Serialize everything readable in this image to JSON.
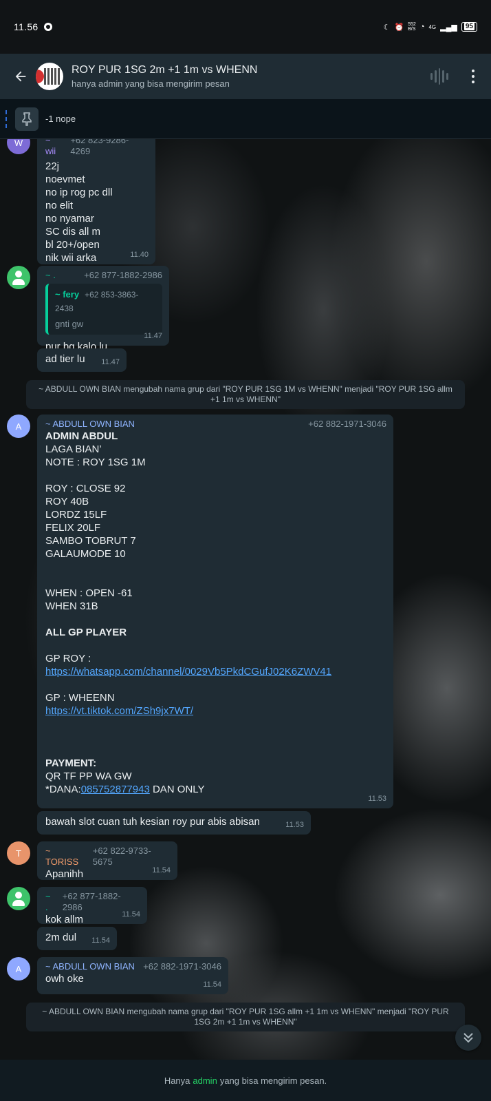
{
  "status_bar": {
    "time": "11.56",
    "net_speed_top": "552",
    "net_speed_bottom": "B/S",
    "network": "4G",
    "battery": "95"
  },
  "header": {
    "title": "ROY PUR 1SG 2m +1 1m vs WHENN",
    "subtitle": "hanya admin yang bisa mengirim pesan"
  },
  "pinned": {
    "text": "-1 nope"
  },
  "messages": {
    "m1": {
      "avatar_letter": "W",
      "name": "~ wii",
      "phone": "+62 823-9286-4269",
      "body": "22j\nnoevmet\nno ip rog pc dll\nno elit\nno nyamar\nSC dis all m\nbl 20+/open\nnik wii arka",
      "time": "11.40",
      "name_color": "#a78bfa"
    },
    "m2": {
      "name": "~ .",
      "phone": "+62 877-1882-2986",
      "quote_name": "~ fery",
      "quote_phone": "+62 853-3863-2438",
      "quote_text": "gnti gw",
      "body": "pur bg kalo lu",
      "time": "11.47",
      "name_color": "#06cf9c"
    },
    "m3": {
      "body": "ad tier lu",
      "time": "11.47"
    },
    "sys1": "~ ABDULL OWN BIAN mengubah nama grup dari \"ROY PUR 1SG 1M vs WHENN\" menjadi \"ROY PUR 1SG allm +1 1m vs WHENN\"",
    "m4": {
      "avatar_letter": "A",
      "name": "~ ABDULL OWN BIAN",
      "phone": "+62 882-1971-3046",
      "line_admin": "ADMIN ABDUL",
      "lines_1": "LAGA BIAN’\nNOTE : ROY 1SG 1M\n\nROY : CLOSE 92\nROY 40B\nLORDZ 15LF\nFELIX 20LF\nSAMBO TOBRUT 7\nGALAUMODE 10\n\n\nWHEN : OPEN -61\nWHEN 31B\n\n",
      "line_allgp": "ALL GP PLAYER",
      "gp_roy_label": "GP ROY :",
      "gp_roy_link": "https://whatsapp.com/channel/0029Vb5PkdCGufJ02K6ZWV41",
      "gp_when_label": "GP : WHEENN",
      "gp_when_link": "https://vt.tiktok.com/ZSh9jx7WT/",
      "payment_label": "PAYMENT:",
      "payment_line": "QR TF PP WA GW",
      "dana_prefix": "*DANA:",
      "dana_number": "085752877943",
      "dana_suffix": " DAN ONLY",
      "time": "11.53",
      "name_color": "#8fb4ff"
    },
    "m5": {
      "body": "bawah slot cuan tuh kesian roy pur abis abisan",
      "time": "11.53"
    },
    "m6": {
      "avatar_letter": "T",
      "name": "~ TORISS",
      "phone": "+62 822-9733-5675",
      "body": "Apanihh",
      "time": "11.54",
      "name_color": "#f39c6b"
    },
    "m7": {
      "name": "~ .",
      "phone": "+62 877-1882-2986",
      "body": "kok allm",
      "time": "11.54",
      "name_color": "#06cf9c"
    },
    "m8": {
      "body": "2m dul",
      "time": "11.54"
    },
    "m9": {
      "avatar_letter": "A",
      "name": "~ ABDULL OWN BIAN",
      "phone": "+62 882-1971-3046",
      "body": "owh oke",
      "time": "11.54",
      "name_color": "#8fb4ff"
    },
    "sys2": "~ ABDULL OWN BIAN mengubah nama grup dari \"ROY PUR 1SG allm +1 1m vs WHENN\" menjadi \"ROY PUR 1SG 2m +1 1m vs WHENN\""
  },
  "footer": {
    "prefix": "Hanya",
    "admin": "admin",
    "suffix": "yang bisa mengirim pesan."
  },
  "colors": {
    "bubble": "#1f2c34",
    "header": "#1f2c34",
    "link": "#53a6fd",
    "admin_green": "#25d366"
  }
}
